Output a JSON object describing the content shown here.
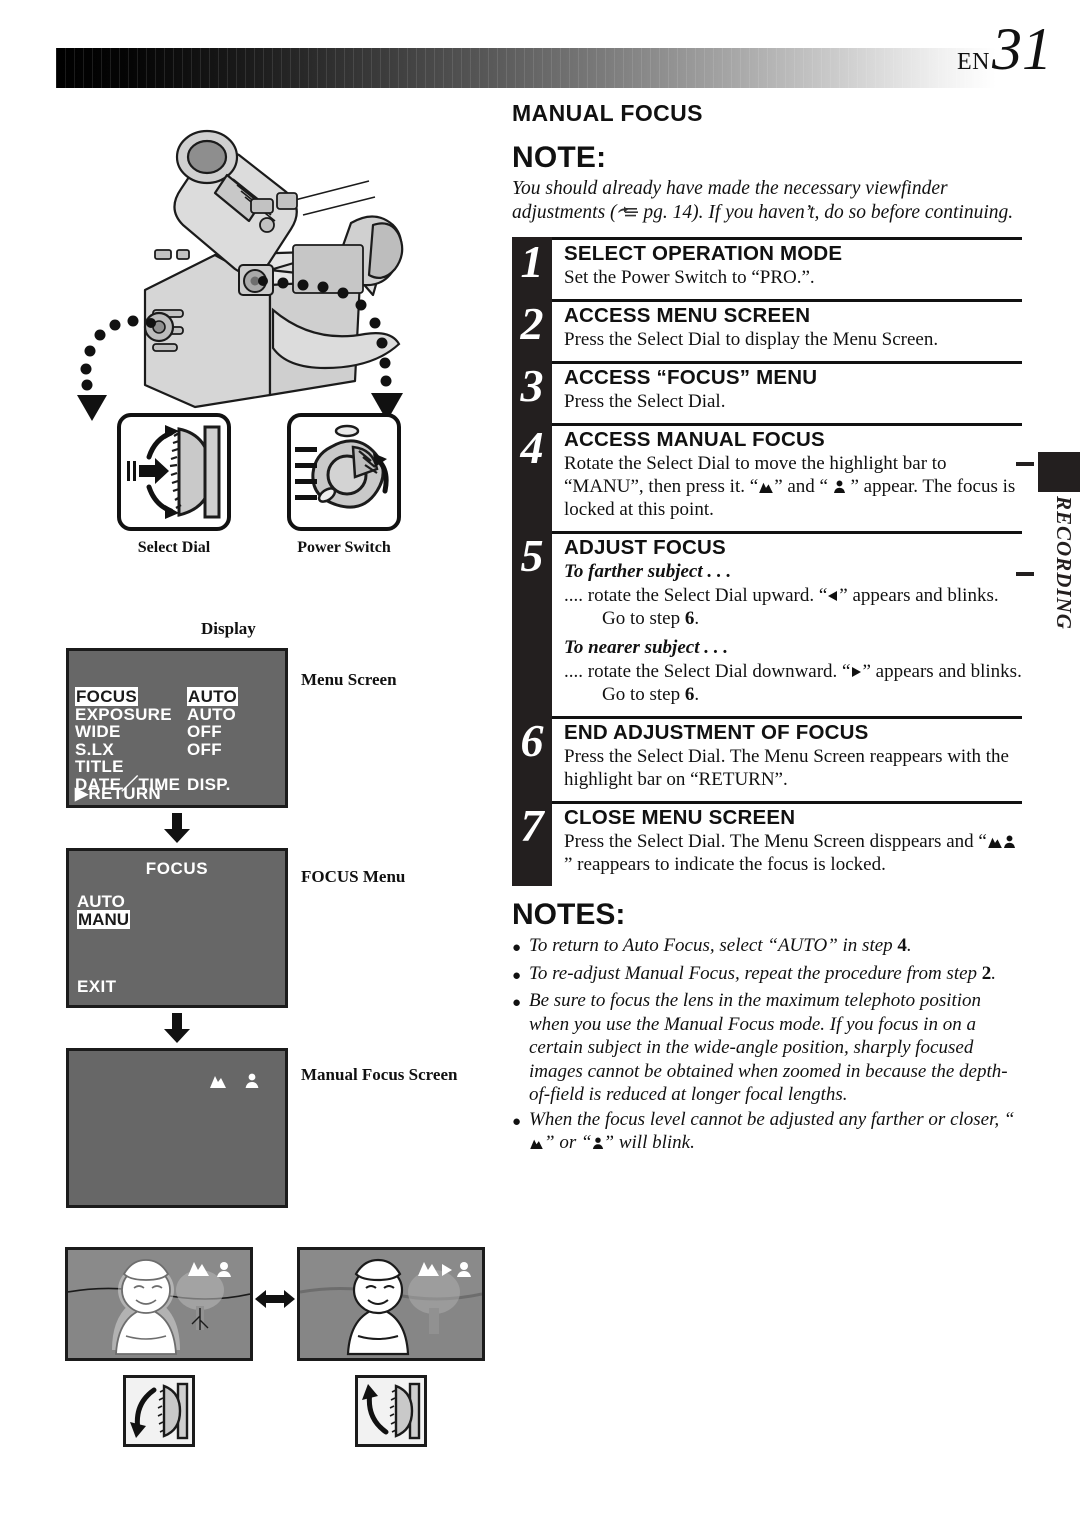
{
  "header": {
    "lang": "EN",
    "page_number": "31"
  },
  "section": {
    "title": "MANUAL FOCUS"
  },
  "note": {
    "heading": "NOTE:",
    "text_before_ref": "You should already have made the necessary viewfinder adjustments (",
    "ref_icon": "pointing-hand-icon",
    "ref": "pg. 14",
    "text_after_ref": "). If you haven’t, do so before continuing."
  },
  "steps": [
    {
      "number": "1",
      "title": "SELECT OPERATION MODE",
      "lines": [
        "Set the Power Switch to “PRO.”."
      ]
    },
    {
      "number": "2",
      "title": "ACCESS MENU SCREEN",
      "lines": [
        "Press the Select Dial to display the Menu Screen."
      ]
    },
    {
      "number": "3",
      "title": "ACCESS “FOCUS” MENU",
      "lines": [
        "Press the Select Dial."
      ]
    },
    {
      "number": "4",
      "title": "ACCESS MANUAL FOCUS",
      "lines": [
        "Rotate the Select Dial to move the highlight bar to “MANU”, then press it. “",
        "” and “",
        "” appear. The focus is locked at this point."
      ]
    },
    {
      "number": "5",
      "title": "ADJUST FOCUS",
      "sub_farther_head": "To farther subject . . .",
      "sub_farther_text_a": ".... rotate the Select Dial upward. “",
      "sub_farther_text_b": "” appears and blinks.",
      "sub_farther_goto": "Go to step",
      "sub_farther_goto_num": "6",
      "sub_nearer_head": "To nearer subject . . .",
      "sub_nearer_text_a": ".... rotate the Select Dial downward. “",
      "sub_nearer_text_b": "” appears and blinks.",
      "sub_nearer_goto": "Go to step",
      "sub_nearer_goto_num": "6"
    },
    {
      "number": "6",
      "title": "END ADJUSTMENT OF FOCUS",
      "lines": [
        "Press the Select Dial. The Menu Screen reappears with the highlight bar on “RETURN”."
      ]
    },
    {
      "number": "7",
      "title": "CLOSE MENU SCREEN",
      "lines": [
        "Press the Select Dial. The Menu Screen disppears and “",
        "” reappears to indicate the focus is locked."
      ]
    }
  ],
  "notes": {
    "heading": "NOTES:",
    "items": [
      {
        "text_a": "To return to Auto Focus, select “AUTO” in step ",
        "bold": "4",
        "text_b": "."
      },
      {
        "text_a": "To re-adjust Manual Focus, repeat the procedure from step ",
        "bold": "2",
        "text_b": "."
      },
      {
        "text_a": "Be sure to focus the lens in the maximum telephoto position when you use the Manual Focus mode. If you focus in on a certain subject in the wide-angle position, sharply focused images cannot be obtained when zoomed in because the depth-of-field is reduced at longer focal lengths.",
        "bold": "",
        "text_b": ""
      },
      {
        "text_a": "When the focus level cannot be adjusted any farther or closer, “",
        "bold": "",
        "text_b": "” or “",
        "text_c": "” will blink."
      }
    ]
  },
  "side_tab": {
    "label": "RECORDING"
  },
  "illustrations": {
    "camera_alt": "camcorder-illustration",
    "controls": [
      {
        "name": "select-dial",
        "label": "Select Dial"
      },
      {
        "name": "power-switch",
        "label": "Power Switch"
      }
    ],
    "display_label": "Display"
  },
  "osd": {
    "menu_screen": {
      "caption": "Menu Screen",
      "rows": [
        {
          "name": "FOCUS",
          "value": "AUTO",
          "name_highlight": true,
          "value_highlight": true
        },
        {
          "name": "EXPOSURE",
          "value": "AUTO",
          "name_highlight": false,
          "value_highlight": false
        },
        {
          "name": "WIDE",
          "value": "OFF",
          "name_highlight": false,
          "value_highlight": false
        },
        {
          "name": "S.LX",
          "value": "OFF",
          "name_highlight": false,
          "value_highlight": false
        },
        {
          "name": "TITLE",
          "value": "",
          "name_highlight": false,
          "value_highlight": false
        },
        {
          "name": "DATE／TIME",
          "value": "DISP.",
          "name_highlight": false,
          "value_highlight": false
        }
      ],
      "return_label": "▶RETURN"
    },
    "focus_menu": {
      "caption": "FOCUS Menu",
      "title": "FOCUS",
      "options": [
        {
          "label": "AUTO",
          "highlight": false
        },
        {
          "label": "MANU",
          "highlight": true
        }
      ],
      "exit_label": "EXIT"
    },
    "manual_focus_screen": {
      "caption": "Manual Focus Screen",
      "icons": [
        "mountain-icon",
        "person-icon"
      ]
    }
  },
  "scene_compare": {
    "left": {
      "name": "far-focus-scene",
      "dial_icon": "dial-rotate-up-icon"
    },
    "right": {
      "name": "near-focus-scene",
      "dial_icon": "dial-rotate-down-icon"
    },
    "arrow": "left-right-arrow-icon"
  },
  "colors": {
    "ink": "#231f1f",
    "osd_bg": "#676767",
    "osd_fg": "#ffffff",
    "scene_bg": "#8a8a8a"
  }
}
